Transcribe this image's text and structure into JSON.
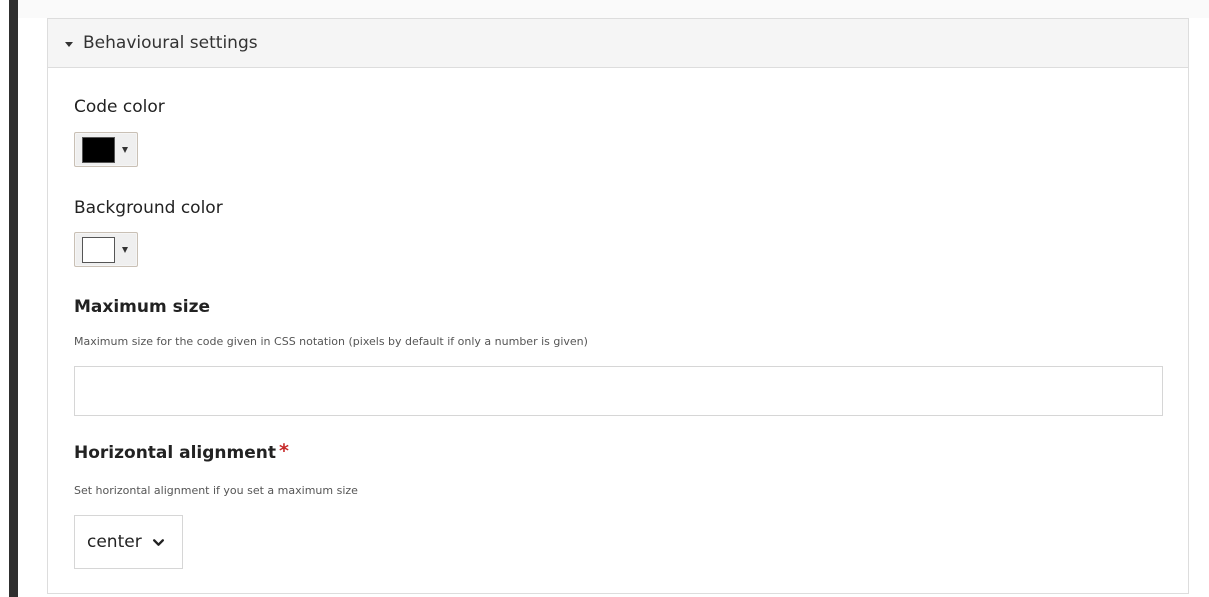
{
  "panel": {
    "title": "Behavioural settings"
  },
  "fields": {
    "code_color": {
      "label": "Code color",
      "value": "#000000"
    },
    "background_color": {
      "label": "Background color",
      "value": "#ffffff"
    },
    "maximum_size": {
      "label": "Maximum size",
      "description": "Maximum size for the code given in CSS notation (pixels by default if only a number is given)",
      "value": ""
    },
    "horizontal_alignment": {
      "label": "Horizontal alignment",
      "required_marker": "*",
      "description": "Set horizontal alignment if you set a maximum size",
      "value": "center"
    }
  },
  "colors": {
    "required": "#c62828",
    "left_bar": "#2f2f2f"
  },
  "icons": {
    "panel_toggle": "caret-down-icon",
    "color_dropdown": "triangle-down-icon",
    "select_dropdown": "chevron-down-icon"
  }
}
